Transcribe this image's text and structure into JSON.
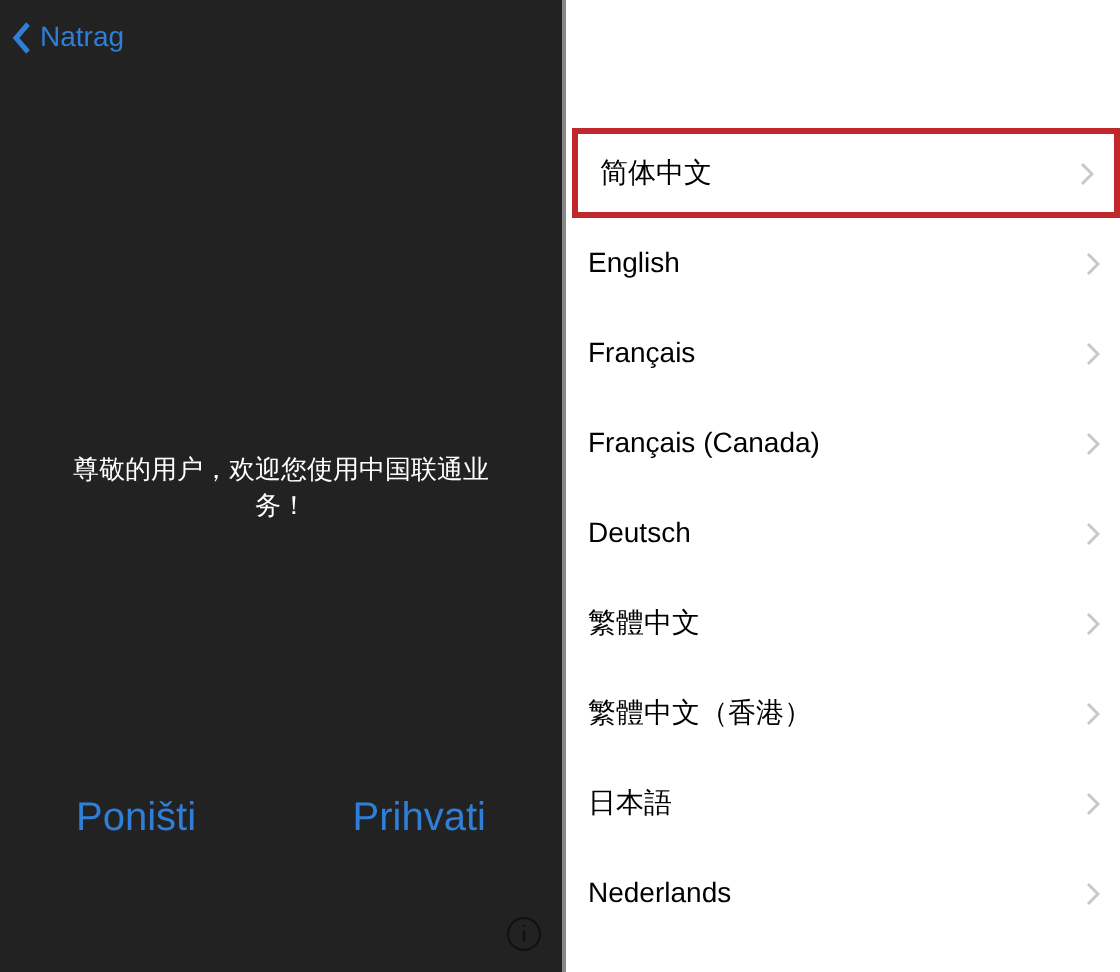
{
  "left_screen": {
    "back_button": "Natrag",
    "message": "尊敬的用户，欢迎您使用中国联通业务！",
    "buttons": [
      "Poništi",
      "Prihvati"
    ]
  },
  "language_list": [
    {
      "label": "简体中文",
      "selected": true
    },
    {
      "label": "English",
      "selected": false
    },
    {
      "label": "Français",
      "selected": false
    },
    {
      "label": "Français (Canada)",
      "selected": false
    },
    {
      "label": "Deutsch",
      "selected": false
    },
    {
      "label": "繁體中文",
      "selected": false
    },
    {
      "label": "繁體中文（香港）",
      "selected": false
    },
    {
      "label": "日本語",
      "selected": false
    },
    {
      "label": "Nederlands",
      "selected": false
    }
  ]
}
